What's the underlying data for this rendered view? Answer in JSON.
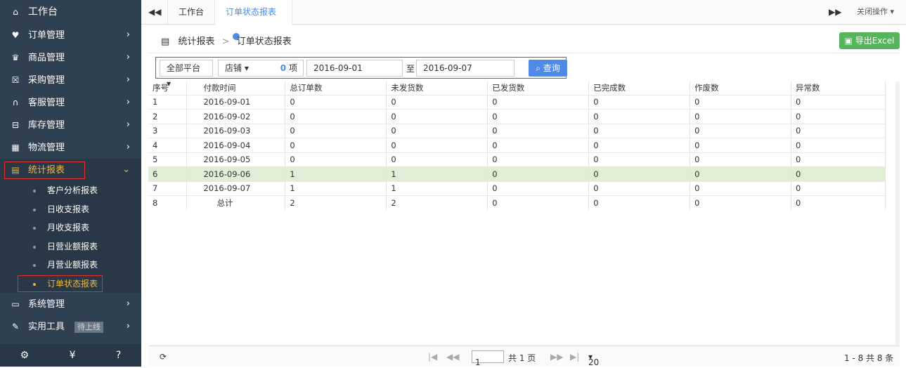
{
  "sidebar": {
    "home": "工作台",
    "items": [
      {
        "icon": "♥",
        "name": "clipboard",
        "label": "订单管理"
      },
      {
        "icon": "♛",
        "name": "gift",
        "label": "商品管理"
      },
      {
        "icon": "☒",
        "name": "cart",
        "label": "采购管理"
      },
      {
        "icon": "∩",
        "name": "headset",
        "label": "客服管理"
      },
      {
        "icon": "⊟",
        "name": "storage",
        "label": "库存管理"
      },
      {
        "icon": "▦",
        "name": "truck",
        "label": "物流管理"
      }
    ],
    "active": "统计报表",
    "sub": [
      "客户分析报表",
      "日收支报表",
      "月收支报表",
      "日营业额报表",
      "月营业额报表",
      "订单状态报表"
    ],
    "after": [
      {
        "name": "monitor",
        "label": "系统管理"
      },
      {
        "name": "wrench",
        "label": "实用工具",
        "badge": "待上线"
      }
    ]
  },
  "tabs": {
    "home": "工作台",
    "active": "订单状态报表",
    "close_ops": "关闭操作"
  },
  "breadcrumb": {
    "parent": "统计报表",
    "sep": ">",
    "current": "订单状态报表"
  },
  "export_label": "导出Excel",
  "filter": {
    "platform": "全部平台",
    "shop": "店铺",
    "count": "0",
    "count_unit": "项",
    "date_from": "2016-09-01",
    "to": "至",
    "date_to": "2016-09-07",
    "query": "查询"
  },
  "columns": [
    "序号",
    "付款时间",
    "总订单数",
    "未发货数",
    "已发货数",
    "已完成数",
    "作废数",
    "异常数"
  ],
  "rows": [
    [
      "1",
      "2016-09-01",
      "0",
      "0",
      "0",
      "0",
      "0",
      "0"
    ],
    [
      "2",
      "2016-09-02",
      "0",
      "0",
      "0",
      "0",
      "0",
      "0"
    ],
    [
      "3",
      "2016-09-03",
      "0",
      "0",
      "0",
      "0",
      "0",
      "0"
    ],
    [
      "4",
      "2016-09-04",
      "0",
      "0",
      "0",
      "0",
      "0",
      "0"
    ],
    [
      "5",
      "2016-09-05",
      "0",
      "0",
      "0",
      "0",
      "0",
      "0"
    ],
    [
      "6",
      "2016-09-06",
      "1",
      "1",
      "0",
      "0",
      "0",
      "0"
    ],
    [
      "7",
      "2016-09-07",
      "1",
      "1",
      "0",
      "0",
      "0",
      "0"
    ],
    [
      "8",
      "总计",
      "2",
      "2",
      "0",
      "0",
      "0",
      "0"
    ]
  ],
  "highlighted_row": 6,
  "pager": {
    "page": "1",
    "total_pages": "共 1 页",
    "page_size": "20",
    "summary": "1 - 8  共 8 条"
  },
  "colors": {
    "sidebar": "#2f4050",
    "active": "#e8b84f",
    "primary": "#4e8ae6",
    "success": "#56b55a",
    "highlight": "#dfeed4"
  }
}
